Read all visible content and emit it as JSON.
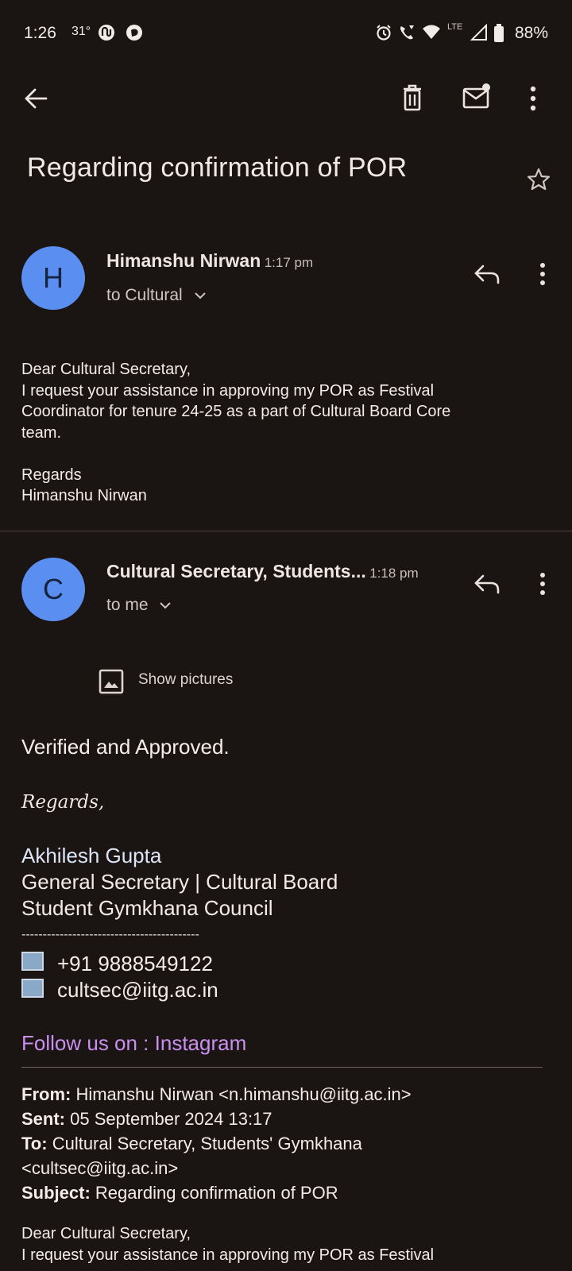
{
  "status_bar": {
    "time": "1:26",
    "temperature": "31°",
    "lte": "LTE",
    "battery": "88%"
  },
  "email": {
    "subject": "Regarding confirmation of POR"
  },
  "message1": {
    "avatar_letter": "H",
    "sender": "Himanshu Nirwan",
    "time": "1:17 pm",
    "to": "to Cultural",
    "body": [
      "Dear Cultural Secretary,",
      "I request your assistance in approving my POR as Festival",
      "Coordinator for tenure 24-25 as a part of Cultural Board Core",
      "team.",
      "",
      "Regards",
      "Himanshu Nirwan"
    ]
  },
  "message2": {
    "avatar_letter": "C",
    "sender": "Cultural Secretary, Students...",
    "time": "1:18 pm",
    "to": "to me",
    "show_pictures": "Show pictures",
    "verified": "Verified and Approved.",
    "regards": "Regards,",
    "signature": {
      "name": "Akhilesh Gupta",
      "title": "General Secretary | Cultural Board",
      "org": "Student Gymkhana Council",
      "dashes": "------------------------------------------",
      "phone": "+91 9888549122",
      "email": "cultsec@iitg.ac.in"
    },
    "follow": "Follow us on : Instagram",
    "quoted": {
      "from_label": "From:",
      "from_value": " Himanshu Nirwan <n.himanshu@iitg.ac.in>",
      "sent_label": "Sent:",
      "sent_value": " 05 September 2024 13:17",
      "to_label": "To:",
      "to_value": " Cultural Secretary, Students' Gymkhana",
      "to_value2": "<cultsec@iitg.ac.in>",
      "subject_label": "Subject:",
      "subject_value": " Regarding confirmation of POR",
      "body_line1": "Dear Cultural Secretary,",
      "body_line2": "I request your assistance in approving my POR as Festival"
    }
  },
  "colors": {
    "background": "#1a1412",
    "avatar": "#5a8ff1",
    "link": "#c990f0"
  }
}
